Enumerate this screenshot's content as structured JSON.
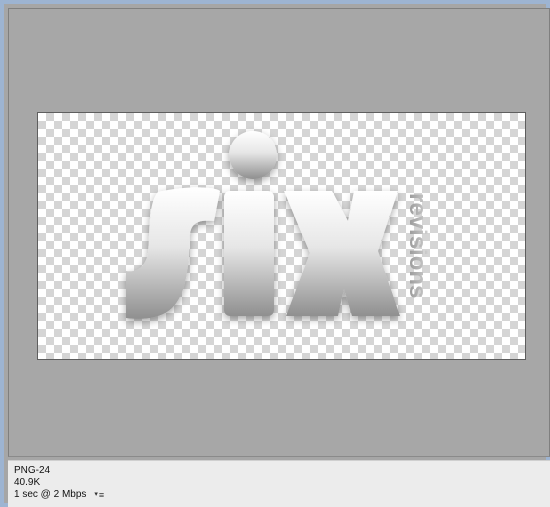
{
  "canvas": {
    "logo_main_text": "six",
    "logo_side_text": "revisions",
    "background": "transparent-checkerboard",
    "checker_light": "#ffffff",
    "checker_dark": "#d5d5d5",
    "logo_gradient_top": "#ffffff",
    "logo_gradient_bottom": "#9a9a9a"
  },
  "status": {
    "format": "PNG-24",
    "file_size": "40.9K",
    "download_time": "1 sec @ 2 Mbps",
    "speed_menu_icon": "dropdown-list-icon"
  },
  "colors": {
    "workspace_bg": "#a6a6a6",
    "window_border": "#9db4d2",
    "status_bg": "#ececec"
  }
}
